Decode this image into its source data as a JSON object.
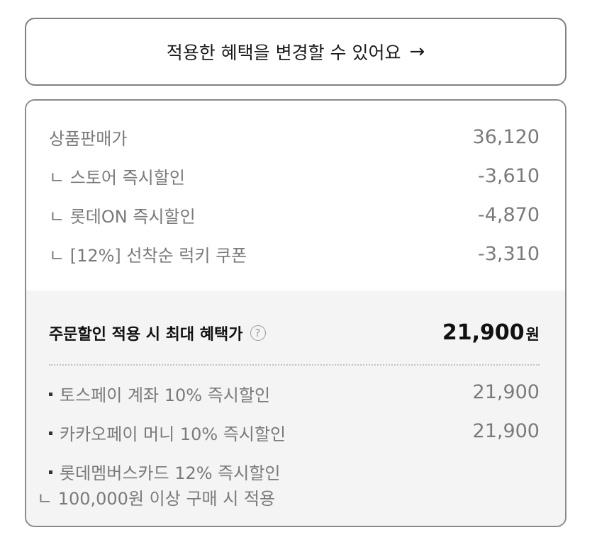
{
  "change_benefit": {
    "label": "적용한 혜택을 변경할 수 있어요",
    "arrow": "→"
  },
  "price_breakdown": {
    "items": [
      {
        "label": "상품판매가",
        "value": "36,120"
      },
      {
        "label": "ㄴ 스토어 즉시할인",
        "value": "-3,610"
      },
      {
        "label": "ㄴ 롯데ON 즉시할인",
        "value": "-4,870"
      },
      {
        "label": "ㄴ [12%] 선착순 럭키 쿠폰",
        "value": "-3,310"
      }
    ]
  },
  "max_benefit": {
    "label": "주문할인 적용 시 최대 혜택가",
    "help_symbol": "?",
    "price": "21,900",
    "unit": "원"
  },
  "payment_discounts": [
    {
      "label": "토스페이 계좌 10% 즉시할인",
      "value": "21,900"
    },
    {
      "label": "카카오페이 머니 10% 즉시할인",
      "value": "21,900"
    },
    {
      "label": "롯데멤버스카드 12% 즉시할인",
      "note": "ㄴ 100,000원 이상 구매 시 적용"
    }
  ]
}
